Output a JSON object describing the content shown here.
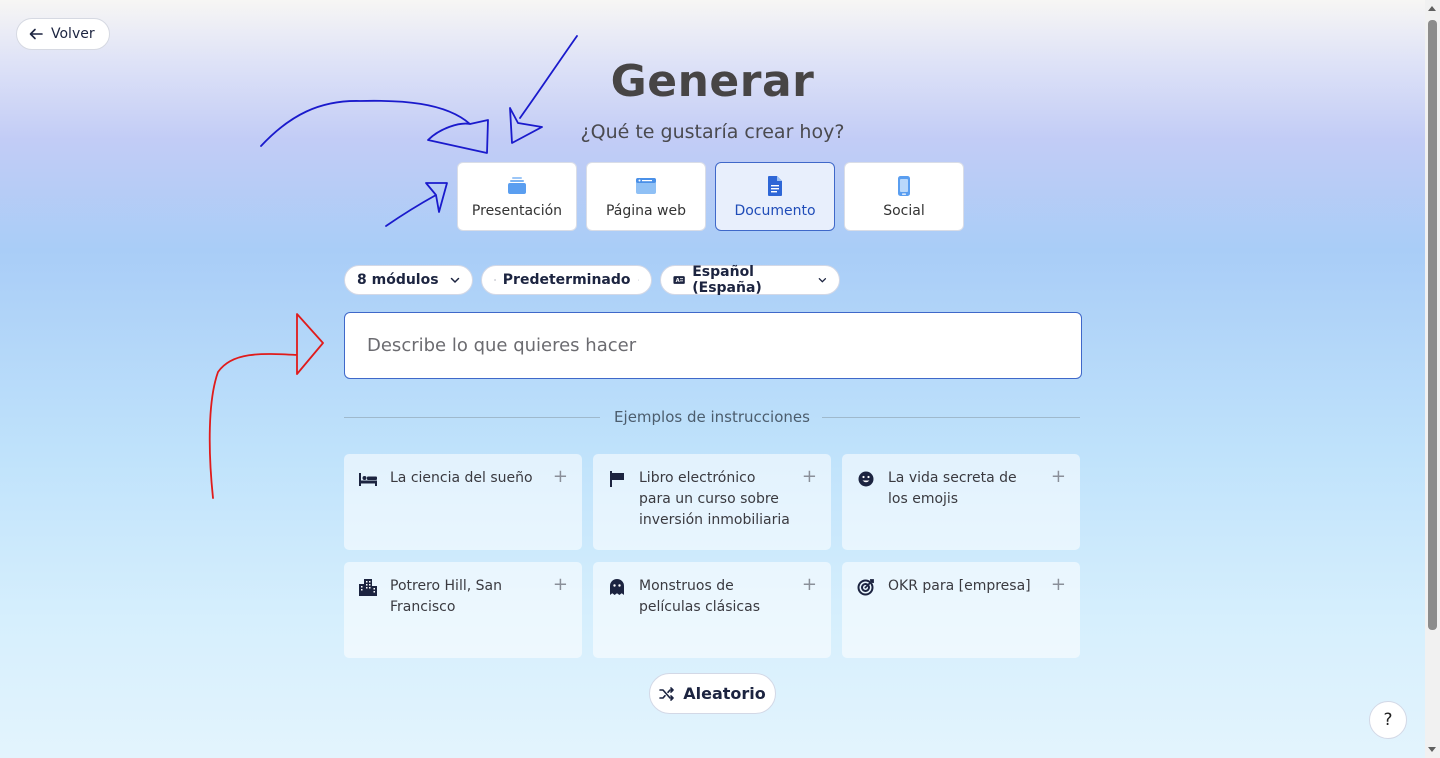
{
  "back": {
    "label": "Volver"
  },
  "header": {
    "title": "Generar",
    "subtitle": "¿Qué te gustaría crear hoy?"
  },
  "types": [
    {
      "label": "Presentación",
      "icon": "presentation-icon",
      "selected": false
    },
    {
      "label": "Página web",
      "icon": "webpage-icon",
      "selected": false
    },
    {
      "label": "Documento",
      "icon": "document-icon",
      "selected": true
    },
    {
      "label": "Social",
      "icon": "phone-icon",
      "selected": false
    }
  ],
  "options": {
    "modules": "8 módulos",
    "format": "Predeterminado",
    "language": "Español (España)"
  },
  "prompt": {
    "placeholder": "Describe lo que quieres hacer",
    "value": ""
  },
  "examples": {
    "heading": "Ejemplos de instrucciones",
    "items": [
      {
        "label": "La ciencia del sueño",
        "icon": "bed-icon"
      },
      {
        "label": "Libro electrónico para un curso sobre inversión inmobiliaria",
        "icon": "sign-icon"
      },
      {
        "label": "La vida secreta de los emojis",
        "icon": "smiley-icon"
      },
      {
        "label": "Potrero Hill, San Francisco",
        "icon": "city-icon"
      },
      {
        "label": "Monstruos de películas clásicas",
        "icon": "ghost-icon"
      },
      {
        "label": "OKR para [empresa]",
        "icon": "target-icon"
      }
    ]
  },
  "random": {
    "label": "Aleatorio"
  },
  "help": {
    "label": "?"
  },
  "colors": {
    "accent": "#3f68c9",
    "navy": "#1c2440",
    "annotation_blue": "#1a1acc",
    "annotation_red": "#e01b1b"
  }
}
